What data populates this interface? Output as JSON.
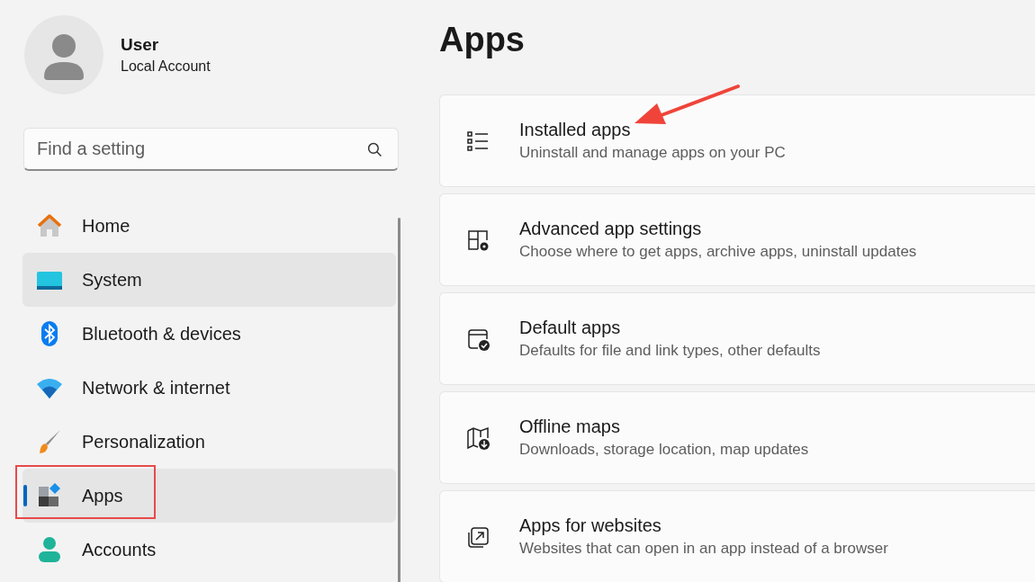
{
  "account": {
    "name": "User",
    "type": "Local Account"
  },
  "search": {
    "placeholder": "Find a setting"
  },
  "nav": [
    {
      "label": "Home",
      "kind": "home",
      "selected": false,
      "hovered": false
    },
    {
      "label": "System",
      "kind": "system",
      "selected": false,
      "hovered": true
    },
    {
      "label": "Bluetooth & devices",
      "kind": "bluetooth",
      "selected": false,
      "hovered": false
    },
    {
      "label": "Network & internet",
      "kind": "network",
      "selected": false,
      "hovered": false
    },
    {
      "label": "Personalization",
      "kind": "personalization",
      "selected": false,
      "hovered": false
    },
    {
      "label": "Apps",
      "kind": "apps",
      "selected": true,
      "hovered": false
    },
    {
      "label": "Accounts",
      "kind": "accounts",
      "selected": false,
      "hovered": false
    }
  ],
  "page": {
    "title": "Apps"
  },
  "cards": [
    {
      "title": "Installed apps",
      "subtitle": "Uninstall and manage apps on your PC",
      "kind": "list"
    },
    {
      "title": "Advanced app settings",
      "subtitle": "Choose where to get apps, archive apps, uninstall updates",
      "kind": "advanced"
    },
    {
      "title": "Default apps",
      "subtitle": "Defaults for file and link types, other defaults",
      "kind": "default"
    },
    {
      "title": "Offline maps",
      "subtitle": "Downloads, storage location, map updates",
      "kind": "maps"
    },
    {
      "title": "Apps for websites",
      "subtitle": "Websites that can open in an app instead of a browser",
      "kind": "websites"
    }
  ]
}
